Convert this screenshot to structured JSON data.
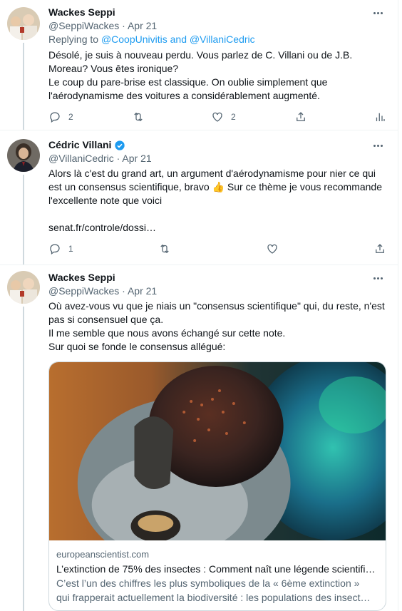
{
  "tweets": [
    {
      "name": "Wackes Seppi",
      "handle_date": "@SeppiWackes · Apr 21",
      "replying_prefix": "Replying to ",
      "replying_to": "@CoopUnivitis and @VillaniCedric",
      "text": "Désolé, je suis à nouveau perdu. Vous parlez de C. Villani ou de J.B. Moreau? Vous êtes ironique?\nLe coup du pare-brise est classique. On oublie simplement que l'aérodynamisme des voitures a considérablement augmenté.",
      "reply_count": "2",
      "like_count": "2"
    },
    {
      "name": "Cédric Villani",
      "handle_date": "@VillaniCedric · Apr 21",
      "text_before": "Alors là c'est du grand art, un argument d'aérodynamisme pour nier ce qui est un consensus scientifique, bravo ",
      "emoji": "👍",
      "text_after": " Sur ce thème je vous recommande l'excellente note que voici",
      "link": "senat.fr/controle/dossi…",
      "reply_count": "1",
      "verified_icon": "verified-badge-icon"
    },
    {
      "name": "Wackes Seppi",
      "handle_date": "@SeppiWackes · Apr 21",
      "text": "Où avez-vous vu que je niais un \"consensus scientifique\" qui, du reste, n'est pas si consensuel que ça.\nIl me semble que nous avons échangé sur cette note.\nSur quoi se fonde le consensus allégué:",
      "card": {
        "domain": "europeanscientist.com",
        "title": "L’extinction de 75% des insectes : Comment naît une légende scientifi…",
        "desc_line1": "C’est l’un des chiffres les plus symboliques de la « 6ème extinction »",
        "desc_line2": "qui frapperait actuellement la biodiversité : les populations des insect…"
      }
    }
  ],
  "colors": {
    "link": "#1d9bf0",
    "secondary": "#536471",
    "border": "#cfd9de"
  }
}
